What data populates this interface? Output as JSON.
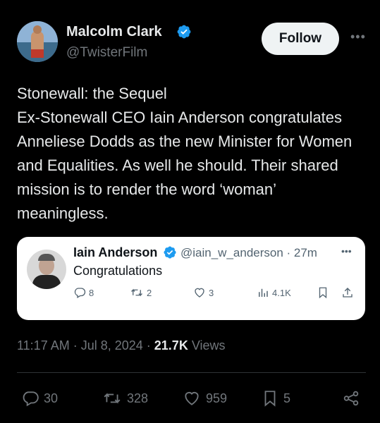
{
  "author": {
    "name": "Malcolm Clark",
    "handle": "@TwisterFilm",
    "follow_label": "Follow",
    "more_label": "•••"
  },
  "tweet": {
    "text": "Stonewall: the Sequel\nEx-Stonewall CEO Iain Anderson congratulates Anneliese Dodds as the new Minister for Women and Equalities. As well he should. Their shared mission is to render the word ‘woman’ meaningless."
  },
  "quote": {
    "name": "Iain Anderson",
    "handle_time": "@iain_w_anderson · 27m",
    "more_label": "•••",
    "text": "Congratulations",
    "replies": "8",
    "retweets": "2",
    "likes": "3",
    "views": "4.1K"
  },
  "meta": {
    "time_date": "11:17 AM · Jul 8, 2024 · ",
    "views_count": "21.7K",
    "views_label": " Views"
  },
  "actions": {
    "replies": "30",
    "retweets": "328",
    "likes": "959",
    "bookmarks": "5"
  },
  "colors": {
    "background": "#000000",
    "verified_blue": "#1d9bf0",
    "muted_text": "#71767b"
  }
}
